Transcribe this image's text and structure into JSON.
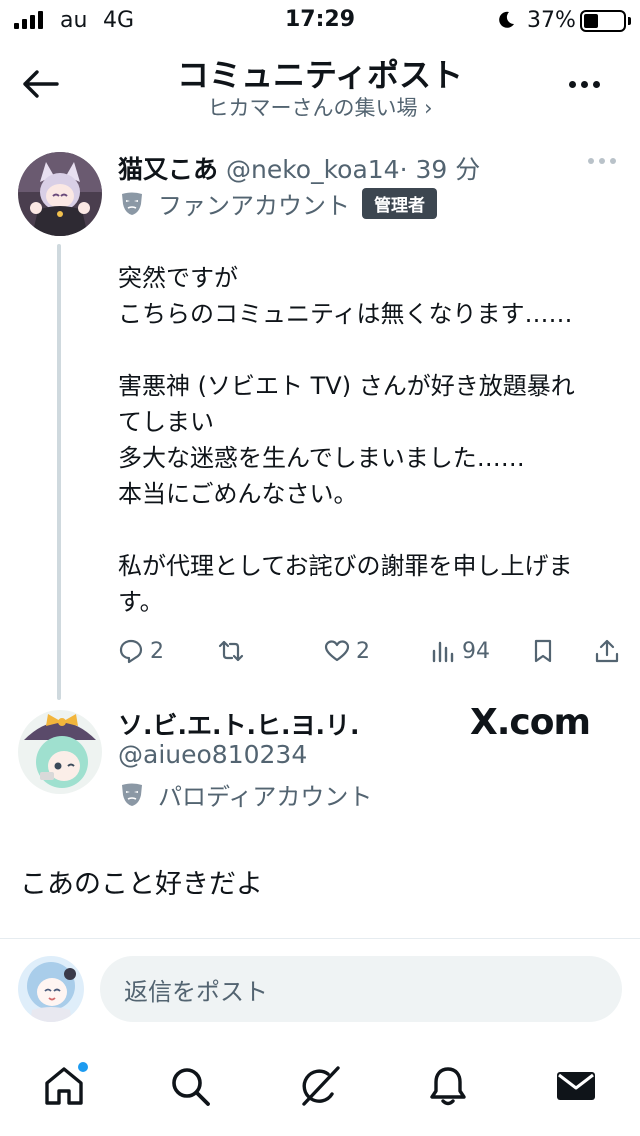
{
  "status_bar": {
    "carrier": "au",
    "network": "4G",
    "time": "17:29",
    "battery_percent": "37%",
    "battery_level": 0.37
  },
  "header": {
    "title": "コミュニティポスト",
    "subtitle": "ヒカマーさんの集い場 ›"
  },
  "post": {
    "display_name": "猫又こあ",
    "handle": "@neko_koa14",
    "time": "· 39 分",
    "account_label": "ファンアカウント",
    "role_badge": "管理者",
    "body_lines": [
      "突然ですが",
      "こちらのコミュニティは無くなります……",
      "",
      "害悪神 (ソビエト TV) さんが好き放題暴れ",
      "てしまい",
      "多大な迷惑を生んでしまいました……",
      "本当にごめんなさい。",
      "",
      "私が代理としてお詫びの謝罪を申し上げま",
      "す。"
    ],
    "replies": "2",
    "likes": "2",
    "views": "94"
  },
  "reply_post": {
    "display_name": "ソ.ビ.エ.ト.ヒ.ヨ.リ.",
    "handle": "@aiueo810234",
    "account_label": "パロディアカウント",
    "watermark": "X.com",
    "text": "こあのこと好きだよ"
  },
  "composer": {
    "placeholder": "返信をポスト"
  },
  "colors": {
    "text": "#0f1419",
    "secondary": "#536471",
    "accent": "#1d9bf0",
    "badge": "#3c4650"
  },
  "icons": [
    "back-arrow-icon",
    "more-icon",
    "mask-icon",
    "reply-icon",
    "repost-icon",
    "like-icon",
    "views-icon",
    "bookmark-icon",
    "share-icon",
    "home-icon",
    "search-icon",
    "grok-icon",
    "bell-icon",
    "mail-icon"
  ]
}
